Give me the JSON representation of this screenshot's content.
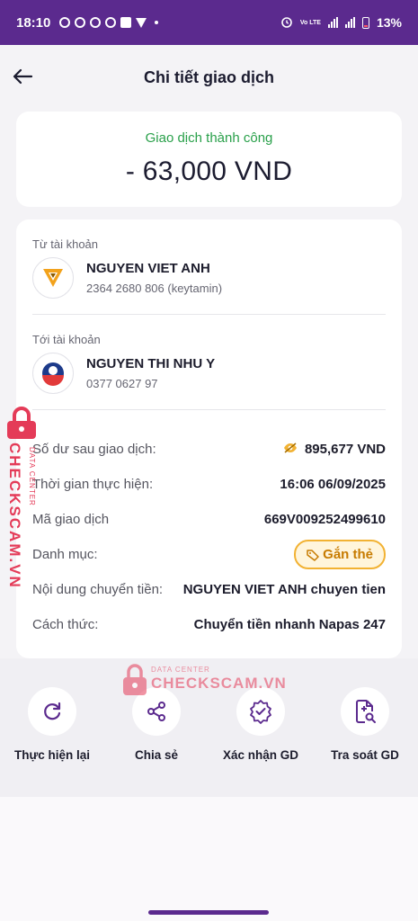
{
  "status_bar": {
    "time": "18:10",
    "battery": "13%",
    "network": "4G",
    "volte": "Vo LTE"
  },
  "header": {
    "title": "Chi tiết giao dịch"
  },
  "summary": {
    "status": "Giao dịch thành công",
    "amount": "- 63,000 VND"
  },
  "from_account": {
    "label": "Từ tài khoản",
    "name": "NGUYEN VIET ANH",
    "number": "2364 2680 806 (keytamin)",
    "logo_color": "#f2a21c"
  },
  "to_account": {
    "label": "Tới tài khoản",
    "name": "NGUYEN THI NHU Y",
    "number": "0377 0627 97",
    "logo_color": "#1d3a8a"
  },
  "details": {
    "balance_label": "Số dư sau giao dịch:",
    "balance_value": "895,677 VND",
    "time_label": "Thời gian thực hiện:",
    "time_value": "16:06 06/09/2025",
    "code_label": "Mã giao dịch",
    "code_value": "669V009252499610",
    "category_label": "Danh mục:",
    "category_button": "Gắn thẻ",
    "content_label": "Nội dung chuyển tiền:",
    "content_value": "NGUYEN VIET ANH chuyen tien",
    "method_label": "Cách thức:",
    "method_value": "Chuyển tiền nhanh Napas 247"
  },
  "actions": [
    {
      "label": "Thực hiện lại",
      "icon": "refresh-icon"
    },
    {
      "label": "Chia sẻ",
      "icon": "share-icon"
    },
    {
      "label": "Xác nhận GD",
      "icon": "verified-badge-icon"
    },
    {
      "label": "Tra soát GD",
      "icon": "document-search-icon"
    }
  ],
  "watermark": {
    "brand": "CHECKSCAM.VN",
    "sub": "DATA CENTER",
    "color": "#e43b58"
  },
  "colors": {
    "brand_purple": "#5b2a8e",
    "success_green": "#29a04a",
    "tag_orange": "#f2b233"
  }
}
